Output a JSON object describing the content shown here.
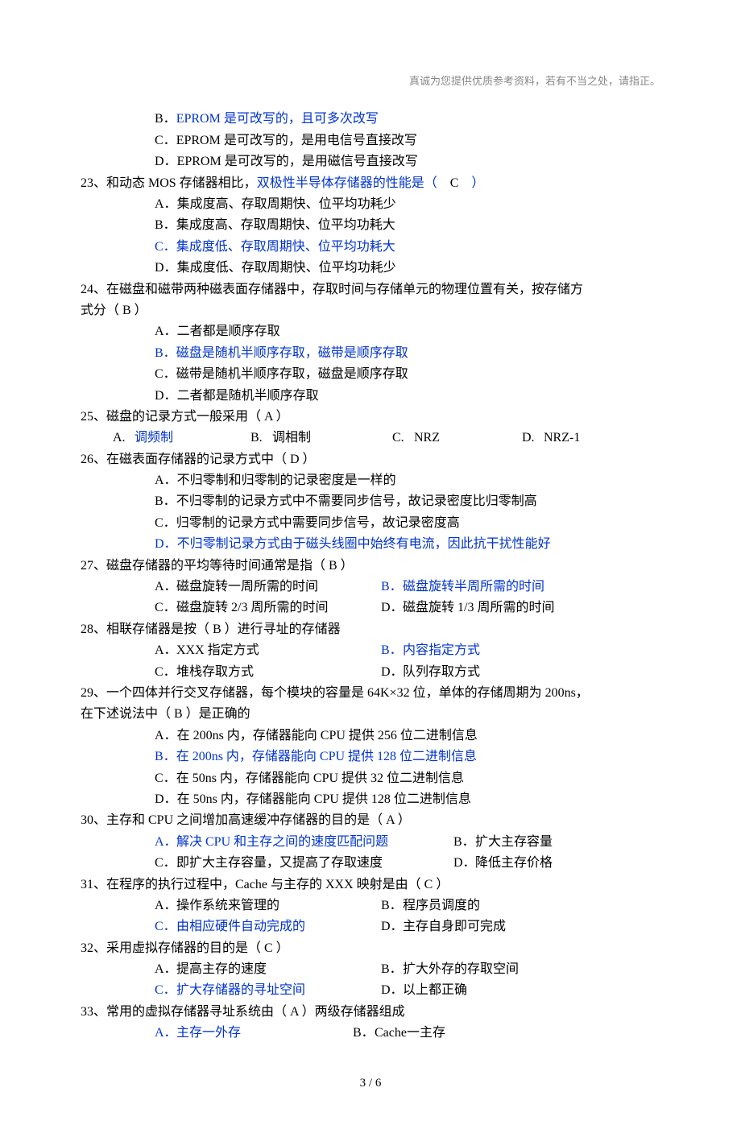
{
  "header": "真诚为您提供优质参考资料，若有不当之处，请指正。",
  "q22": {
    "optB": "EPROM 是可改写的，且可多次改写",
    "optC": "EPROM 是可改写的，是用电信号直接改写",
    "optD": "EPROM 是可改写的，是用磁信号直接改写"
  },
  "q23": {
    "stem_a": "23、和动态 MOS 存储器相比，",
    "stem_b": "双极性半导体存储器的性能是（",
    "stem_c": "C",
    "stem_d": "）",
    "optA": "集成度高、存取周期快、位平均功耗少",
    "optB": "集成度高、存取周期快、位平均功耗大",
    "optC": "集成度低、存取周期快、位平均功耗大",
    "optD": "集成度低、存取周期快、位平均功耗少"
  },
  "q24": {
    "stem_l1": "24、在磁盘和磁带两种磁表面存储器中，存取时间与存储单元的物理位置有关，按存储方",
    "stem_l2": "式分（    B    ）",
    "optA": "二者都是顺序存取",
    "optB": "磁盘是随机半顺序存取，磁带是顺序存取",
    "optC": "磁带是随机半顺序存取，磁盘是顺序存取",
    "optD": "二者都是随机半顺序存取"
  },
  "q25": {
    "stem": "25、磁盘的记录方式一般采用（    A    ）",
    "A_lbl": "A.",
    "A_txt": "调频制",
    "B_lbl": "B.",
    "B_txt": "调相制",
    "C_lbl": "C.",
    "C_txt": "NRZ",
    "D_lbl": "D.",
    "D_txt": "NRZ-1"
  },
  "q26": {
    "stem": "26、在磁表面存储器的记录方式中（      D    ）",
    "optA": "不归零制和归零制的记录密度是一样的",
    "optB": "不归零制的记录方式中不需要同步信号，故记录密度比归零制高",
    "optC": "归零制的记录方式中需要同步信号，故记录密度高",
    "optD": "不归零制记录方式由于磁头线圈中始终有电流，因此抗干扰性能好"
  },
  "q27": {
    "stem": "27、磁盘存储器的平均等待时间通常是指（      B    ）",
    "A": "磁盘旋转一周所需的时间",
    "B": "磁盘旋转半周所需的时间",
    "C": "磁盘旋转 2/3 周所需的时间",
    "D": "磁盘旋转 1/3 周所需的时间"
  },
  "q28": {
    "stem": "28、相联存储器是按（    B      ）进行寻址的存储器",
    "A": "XXX 指定方式",
    "B": "内容指定方式",
    "C": "堆栈存取方式",
    "D": "队列存取方式"
  },
  "q29": {
    "stem_l1": "29、一个四体并行交叉存储器，每个模块的容量是 64K×32 位，单体的存储周期为 200ns，",
    "stem_l2": "在下述说法中（    B    ）是正确的",
    "A": "在 200ns 内，存储器能向 CPU 提供 256 位二进制信息",
    "B": "在 200ns 内，存储器能向 CPU 提供 128 位二进制信息",
    "C": "在 50ns 内，存储器能向 CPU 提供 32 位二进制信息",
    "D": "在 50ns 内，存储器能向 CPU 提供 128 位二进制信息"
  },
  "q30": {
    "stem": "30、主存和 CPU 之间增加高速缓冲存储器的目的是（      A    ）",
    "A": "解决 CPU 和主存之间的速度匹配问题",
    "B": "扩大主存容量",
    "C": "即扩大主存容量，又提高了存取速度",
    "D": "降低主存价格"
  },
  "q31": {
    "stem": "31、在程序的执行过程中，Cache 与主存的 XXX 映射是由（      C    ）",
    "A": "操作系统来管理的",
    "B": "程序员调度的",
    "C": "由相应硬件自动完成的",
    "D": "主存自身即可完成"
  },
  "q32": {
    "stem": "32、采用虚拟存储器的目的是（    C  ）",
    "A": "提高主存的速度",
    "B": "扩大外存的存取空间",
    "C": "扩大存储器的寻址空间",
    "D": "以上都正确"
  },
  "q33": {
    "stem": "33、常用的虚拟存储器寻址系统由（    A    ）两级存储器组成",
    "A": "主存一外存",
    "B": "Cache一主存"
  },
  "footer": "3  /  6"
}
